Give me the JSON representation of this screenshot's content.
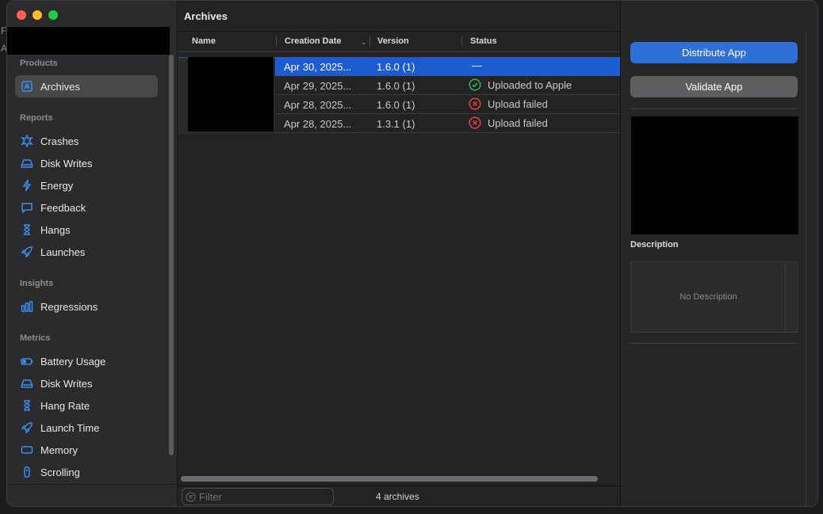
{
  "backdrop": {
    "line1": "F",
    "line2": "A"
  },
  "sidebar": {
    "sections": [
      {
        "title": "Products",
        "items": [
          {
            "label": "Archives",
            "icon": "archive-icon",
            "selected": true
          }
        ]
      },
      {
        "title": "Reports",
        "items": [
          {
            "label": "Crashes",
            "icon": "crash-icon"
          },
          {
            "label": "Disk Writes",
            "icon": "disk-icon"
          },
          {
            "label": "Energy",
            "icon": "bolt-icon"
          },
          {
            "label": "Feedback",
            "icon": "feedback-icon"
          },
          {
            "label": "Hangs",
            "icon": "hourglass-icon"
          },
          {
            "label": "Launches",
            "icon": "rocket-icon"
          }
        ]
      },
      {
        "title": "Insights",
        "items": [
          {
            "label": "Regressions",
            "icon": "bars-icon"
          }
        ]
      },
      {
        "title": "Metrics",
        "items": [
          {
            "label": "Battery Usage",
            "icon": "battery-icon"
          },
          {
            "label": "Disk Writes",
            "icon": "disk-icon"
          },
          {
            "label": "Hang Rate",
            "icon": "hourglass-icon"
          },
          {
            "label": "Launch Time",
            "icon": "rocket-icon"
          },
          {
            "label": "Memory",
            "icon": "memory-icon"
          },
          {
            "label": "Scrolling",
            "icon": "scroll-icon"
          }
        ]
      }
    ]
  },
  "main": {
    "title": "Archives",
    "columns": {
      "name": "Name",
      "date": "Creation Date",
      "version": "Version",
      "status": "Status"
    },
    "rows": [
      {
        "date": "Apr 30, 2025...",
        "version": "1.6.0 (1)",
        "status": "—",
        "status_kind": "none",
        "selected": true
      },
      {
        "date": "Apr 29, 2025...",
        "version": "1.6.0 (1)",
        "status": "Uploaded to Apple",
        "status_kind": "success"
      },
      {
        "date": "Apr 28, 2025...",
        "version": "1.6.0 (1)",
        "status": "Upload failed",
        "status_kind": "failed"
      },
      {
        "date": "Apr 28, 2025...",
        "version": "1.3.1 (1)",
        "status": "Upload failed",
        "status_kind": "failed"
      }
    ],
    "filter_placeholder": "Filter",
    "count": "4 archives"
  },
  "right": {
    "distribute": "Distribute App",
    "validate": "Validate App",
    "description_label": "Description",
    "description_empty": "No Description"
  },
  "colors": {
    "accent": "#2f6fd8",
    "selection": "#1d5bd0",
    "success": "#34c759",
    "failure": "#ff453a",
    "icon": "#3b8ef3"
  }
}
